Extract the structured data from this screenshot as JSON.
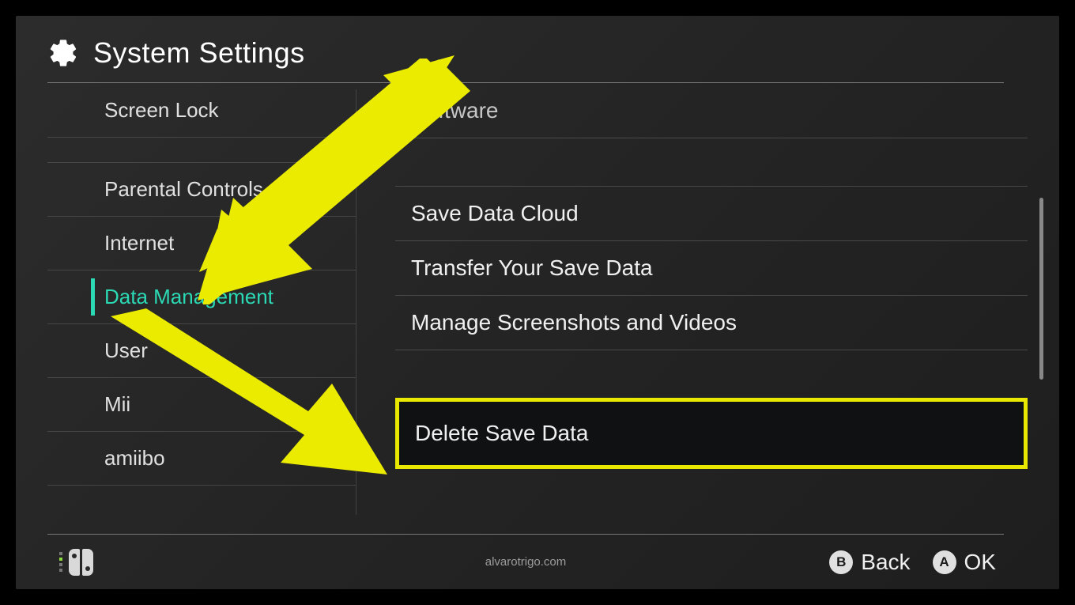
{
  "header": {
    "title": "System Settings"
  },
  "sidebar": {
    "items": [
      {
        "label": "Screen Lock",
        "active": false
      },
      {
        "label": "Parental Controls",
        "active": false
      },
      {
        "label": "Internet",
        "active": false
      },
      {
        "label": "Data Management",
        "active": true
      },
      {
        "label": "User",
        "active": false
      },
      {
        "label": "Mii",
        "active": false
      },
      {
        "label": "amiibo",
        "active": false
      }
    ]
  },
  "main": {
    "items": [
      {
        "label": "Software"
      },
      {
        "label": "Save Data Cloud"
      },
      {
        "label": "Transfer Your Save Data"
      },
      {
        "label": "Manage Screenshots and Videos"
      },
      {
        "label": "Delete Save Data",
        "highlighted": true
      }
    ]
  },
  "footer": {
    "watermark": "alvarotrigo.com",
    "back_key": "B",
    "back_label": "Back",
    "ok_key": "A",
    "ok_label": "OK"
  },
  "annotations": {
    "arrow1_target": "Data Management",
    "arrow2_target": "Delete Save Data",
    "highlight_color": "#e8e800"
  }
}
